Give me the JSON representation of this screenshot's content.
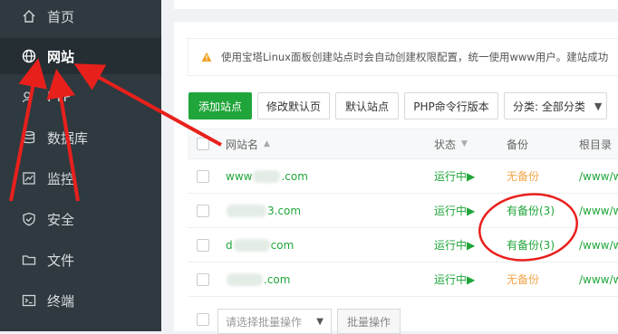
{
  "sidebar": {
    "items": [
      {
        "label": "首页",
        "icon": "home-icon",
        "active": false
      },
      {
        "label": "网站",
        "icon": "globe-icon",
        "active": true
      },
      {
        "label": "FTP",
        "icon": "ftp-icon",
        "active": false
      },
      {
        "label": "数据库",
        "icon": "database-icon",
        "active": false
      },
      {
        "label": "监控",
        "icon": "monitor-icon",
        "active": false
      },
      {
        "label": "安全",
        "icon": "shield-icon",
        "active": false
      },
      {
        "label": "文件",
        "icon": "folder-icon",
        "active": false
      },
      {
        "label": "终端",
        "icon": "terminal-icon",
        "active": false
      }
    ]
  },
  "notice": {
    "text": "使用宝塔Linux面板创建站点时会自动创建权限配置，统一使用www用户。建站成功"
  },
  "toolbar": {
    "add_site": "添加站点",
    "modify_default_page": "修改默认页",
    "default_site": "默认站点",
    "php_cli_version": "PHP命令行版本",
    "category_select": "分类: 全部分类"
  },
  "table": {
    "headers": {
      "site_name": "网站名",
      "status": "状态",
      "backup": "备份",
      "root_dir": "根目录"
    },
    "rows": [
      {
        "name_prefix": "www",
        "name_suffix": ".com",
        "status": "运行中▶",
        "backup": "无备份",
        "backup_state": "none",
        "path": "/www/w"
      },
      {
        "name_prefix": "",
        "name_suffix": "3.com",
        "status": "运行中▶",
        "backup": "有备份(3)",
        "backup_state": "has",
        "path": "/www/w"
      },
      {
        "name_prefix": "d",
        "name_suffix": "com",
        "status": "运行中▶",
        "backup": "有备份(3)",
        "backup_state": "has",
        "path": "/www/w"
      },
      {
        "name_prefix": "",
        "name_suffix": ".com",
        "status": "运行中▶",
        "backup": "无备份",
        "backup_state": "none",
        "path": "/www/w"
      }
    ]
  },
  "bottom": {
    "batch_placeholder": "请选择批量操作",
    "batch_button": "批量操作"
  },
  "colors": {
    "sidebar_bg": "#2f3a40",
    "accent_green": "#20a53a",
    "warning_orange": "#f0a54a",
    "annotation_red": "#e8201c"
  }
}
